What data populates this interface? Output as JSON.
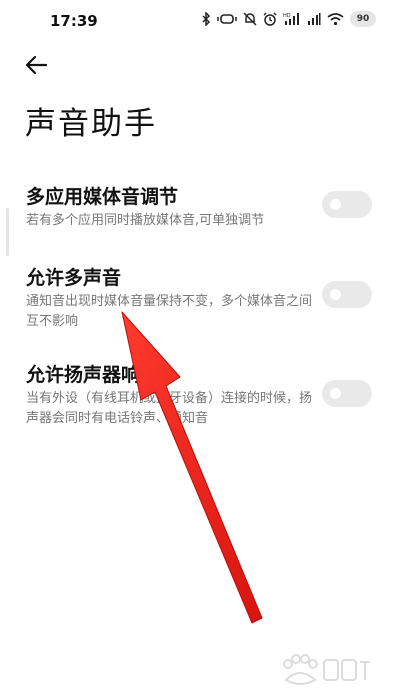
{
  "status_bar": {
    "time": "17:39",
    "battery": "90",
    "icons": [
      "bluetooth-icon",
      "vibrate-icon",
      "mute-bell-icon",
      "alarm-icon",
      "hd-signal-icon",
      "signal-icon",
      "wifi-icon",
      "battery-icon"
    ]
  },
  "header": {
    "back_icon": "arrow-left-icon",
    "title": "声音助手"
  },
  "settings": [
    {
      "title": "多应用媒体音调节",
      "description": "若有多个应用同时播放媒体音,可单独调节",
      "enabled": false
    },
    {
      "title": "允许多声音",
      "description": "通知音出现时媒体音量保持不变，多个媒体音之间互不影响",
      "enabled": false
    },
    {
      "title": "允许扬声器响铃",
      "description": "当有外设（有线耳机或蓝牙设备）连接的时候，扬声器会同时有电话铃声、通知音",
      "enabled": false
    }
  ],
  "colors": {
    "background": "#ffffff",
    "title_text": "#111111",
    "secondary_text": "#777777",
    "toggle_off": "#e9e9e9",
    "annotation_arrow": "#e8231f"
  },
  "watermark_icon": "baidu-jingyan-watermark"
}
